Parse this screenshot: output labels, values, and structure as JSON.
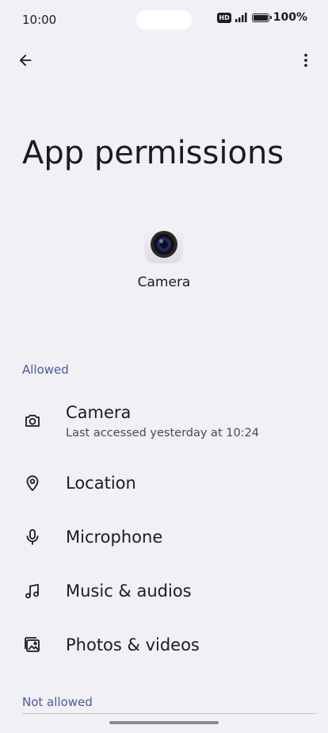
{
  "status": {
    "time": "10:00",
    "network_badge": "HD",
    "battery": "100%"
  },
  "toolbar": {
    "back_icon": "arrow-left-icon",
    "more_icon": "more-vert-icon"
  },
  "page": {
    "title": "App permissions"
  },
  "app": {
    "name": "Camera",
    "icon": "camera-lens-icon"
  },
  "sections": {
    "allowed": "Allowed",
    "not_allowed": "Not allowed"
  },
  "permissions": [
    {
      "label": "Camera",
      "subtitle": "Last accessed yesterday at 10:24",
      "icon": "camera-icon"
    },
    {
      "label": "Location",
      "icon": "location-pin-icon"
    },
    {
      "label": "Microphone",
      "icon": "microphone-icon"
    },
    {
      "label": "Music & audios",
      "icon": "music-note-icon"
    },
    {
      "label": "Photos & videos",
      "icon": "photos-icon"
    }
  ],
  "colors": {
    "background": "#f1f0f5",
    "section_header": "#4a5a9a",
    "text": "#1c1b1f"
  }
}
